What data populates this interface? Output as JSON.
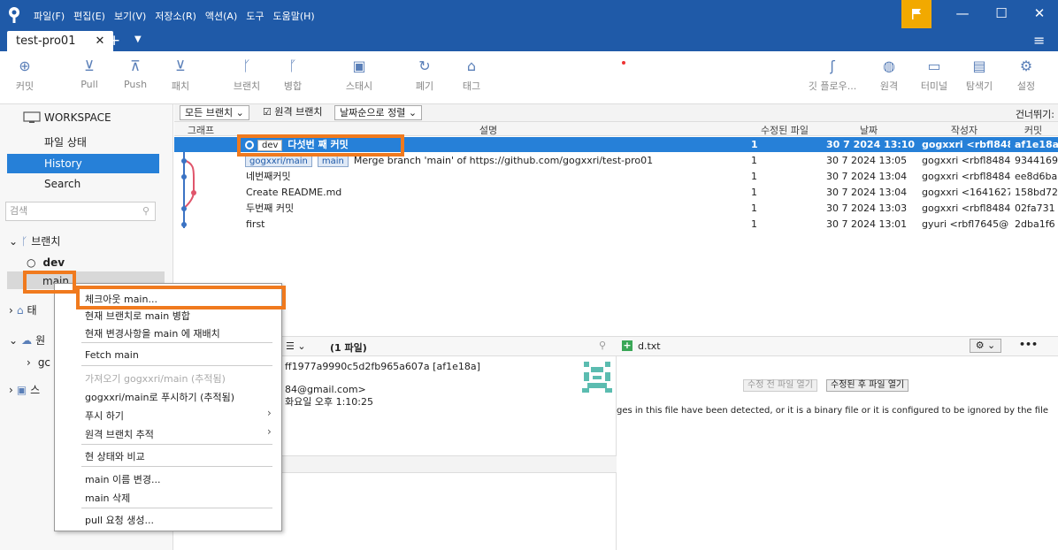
{
  "menu": [
    "파일(F)",
    "편집(E)",
    "보기(V)",
    "저장소(R)",
    "액션(A)",
    "도구",
    "도움말(H)"
  ],
  "tab": {
    "title": "test-pro01"
  },
  "toolbar": {
    "commit": "커밋",
    "pull": "Pull",
    "push": "Push",
    "fetch": "패치",
    "branch": "브랜치",
    "merge": "병합",
    "stash": "스태시",
    "discard": "폐기",
    "tag": "태그",
    "gitflow": "깃 플로우...",
    "remote": "원격",
    "terminal": "터미널",
    "explorer": "탐색기",
    "settings": "설정"
  },
  "sidebar": {
    "workspace": "WORKSPACE",
    "file_status": "파일 상태",
    "history": "History",
    "search": "Search",
    "search_placeholder": "검색",
    "branches": "브랜치",
    "branch_dev": "dev",
    "branch_main": "main",
    "tags": "태",
    "remotes": "원",
    "remote_item": "gc",
    "submodules": "스"
  },
  "filterbar": {
    "all_branches": "모든 브랜치",
    "remote_branches": "원격 브랜치",
    "sort": "날짜순으로 정렬",
    "skip": "건너뛰기:"
  },
  "columns": {
    "graph": "그래프",
    "desc": "설명",
    "files": "수정된 파일",
    "date": "날짜",
    "author": "작성자",
    "commit": "커밋"
  },
  "commits": [
    {
      "tag1": "dev",
      "desc": "다섯번 째 커밋",
      "files": "1",
      "date": "30 7 2024 13:10",
      "author": "gogxxri <rbfl848",
      "hash": "af1e18a"
    },
    {
      "tag1": "gogxxri/main",
      "tag2": "main",
      "desc": "Merge branch 'main' of https://github.com/gogxxri/test-pro01",
      "files": "1",
      "date": "30 7 2024 13:05",
      "author": "gogxxri <rbfl8484",
      "hash": "9344169"
    },
    {
      "desc": "네번째커밋",
      "files": "1",
      "date": "30 7 2024 13:04",
      "author": "gogxxri <rbfl8484",
      "hash": "ee8d6ba"
    },
    {
      "desc": "Create README.md",
      "files": "1",
      "date": "30 7 2024 13:04",
      "author": "gogxxri <1641627",
      "hash": "158bd72"
    },
    {
      "desc": "두번째 커밋",
      "files": "1",
      "date": "30 7 2024 13:03",
      "author": "gogxxri <rbfl8484",
      "hash": "02fa731"
    },
    {
      "desc": "first",
      "files": "1",
      "date": "30 7 2024 13:01",
      "author": "gyuri <rbfl7645@",
      "hash": "2dba1f6"
    }
  ],
  "details": {
    "files_count": "(1 파일)",
    "sha": "ff1977a9990c5d2fb965a607a [af1e18a]",
    "email": "84@gmail.com>",
    "date": "화요일 오후 1:10:25"
  },
  "diff": {
    "filename": "d.txt",
    "open_before": "수정 전 파일 열기",
    "open_after": "수정된 후 파일 열기",
    "message": "ges in this file have been detected, or it is a binary file or it is configured to be ignored by the file"
  },
  "context_menu": {
    "checkout": "체크아웃 main...",
    "merge": "현재 브랜치로 main 병합",
    "rebase": "현재 변경사항을 main 에 재배치",
    "fetch": "Fetch main",
    "pull": "가져오기 gogxxri/main (추적됨)",
    "push": "gogxxri/main로 푸시하기 (추적됨)",
    "push_to": "푸시 하기",
    "track": "원격 브랜치 추적",
    "compare": "현 상태와 비교",
    "rename": "main 이름 변경...",
    "delete": "main 삭제",
    "pr": "pull 요청 생성..."
  },
  "colors": {
    "accent": "#1f5aa8",
    "selection": "#2680d8",
    "highlight": "#f07a1e",
    "flag": "#f2a900"
  }
}
